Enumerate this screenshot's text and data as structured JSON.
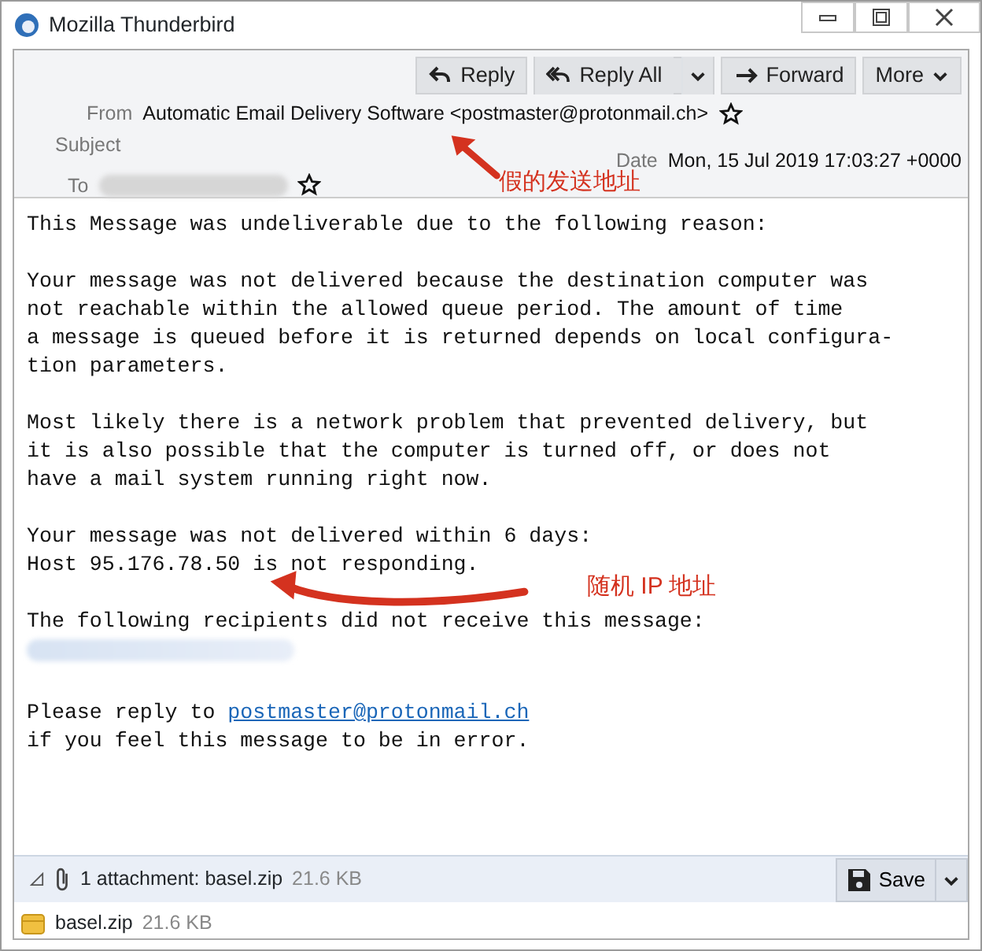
{
  "window": {
    "title": "Mozilla Thunderbird"
  },
  "toolbar": {
    "buttons": [
      {
        "label": "Reply",
        "kind": "reply"
      },
      {
        "label": "Reply All",
        "kind": "reply_all"
      },
      {
        "label": "Forward",
        "kind": "forward"
      },
      {
        "label": "More",
        "kind": "more"
      }
    ]
  },
  "header": {
    "from_label": "From",
    "from": "Automatic Email Delivery Software <postmaster@protonmail.ch>",
    "subject_label": "Subject",
    "date_label": "Date",
    "date": "Mon, 15 Jul 2019 17:03:27 +0000",
    "to_label": "To"
  },
  "body": [
    {
      "kind": "text",
      "text": "This Message was undeliverable due to the following reason:"
    },
    {
      "kind": "text",
      "text": "Your message was not delivered because the destination computer was\nnot reachable within the allowed queue period. The amount of time\na message is queued before it is returned depends on local configura-\ntion parameters."
    },
    {
      "kind": "text",
      "text": "Most likely there is a network problem that prevented delivery, but\nit is also possible that the computer is turned off, or does not\nhave a mail system running right now."
    },
    {
      "kind": "text",
      "text": "Your message was not delivered within 6 days:\nHost 95.176.78.50 is not responding."
    },
    {
      "kind": "redacted_list",
      "text": "The following recipients did not receive this message:"
    },
    {
      "kind": "link",
      "before": "Please reply to ",
      "link": "postmaster@protonmail.ch",
      "after": "\nif you feel this message to be in error."
    }
  ],
  "attachments": {
    "summary": "1 attachment: basel.zip",
    "size": "21.6 KB",
    "save_label": "Save",
    "expanded": true,
    "files": [
      {
        "name": "basel.zip",
        "size": "21.6 KB"
      }
    ]
  },
  "annotations": [
    {
      "text": "假的发送地址",
      "kind": "sender"
    },
    {
      "text": "随机 IP 地址",
      "kind": "ip"
    }
  ]
}
